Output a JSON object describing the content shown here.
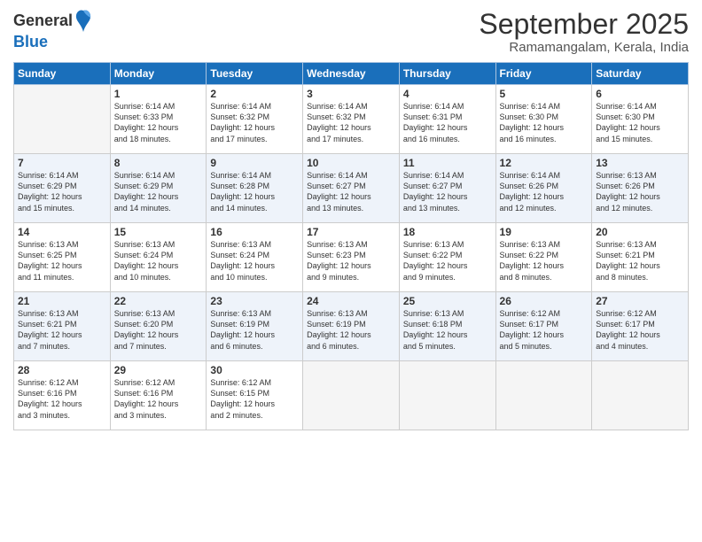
{
  "logo": {
    "general": "General",
    "blue": "Blue"
  },
  "title": "September 2025",
  "location": "Ramamangalam, Kerala, India",
  "days_of_week": [
    "Sunday",
    "Monday",
    "Tuesday",
    "Wednesday",
    "Thursday",
    "Friday",
    "Saturday"
  ],
  "weeks": [
    [
      {
        "day": "",
        "info": ""
      },
      {
        "day": "1",
        "info": "Sunrise: 6:14 AM\nSunset: 6:33 PM\nDaylight: 12 hours\nand 18 minutes."
      },
      {
        "day": "2",
        "info": "Sunrise: 6:14 AM\nSunset: 6:32 PM\nDaylight: 12 hours\nand 17 minutes."
      },
      {
        "day": "3",
        "info": "Sunrise: 6:14 AM\nSunset: 6:32 PM\nDaylight: 12 hours\nand 17 minutes."
      },
      {
        "day": "4",
        "info": "Sunrise: 6:14 AM\nSunset: 6:31 PM\nDaylight: 12 hours\nand 16 minutes."
      },
      {
        "day": "5",
        "info": "Sunrise: 6:14 AM\nSunset: 6:30 PM\nDaylight: 12 hours\nand 16 minutes."
      },
      {
        "day": "6",
        "info": "Sunrise: 6:14 AM\nSunset: 6:30 PM\nDaylight: 12 hours\nand 15 minutes."
      }
    ],
    [
      {
        "day": "7",
        "info": "Sunrise: 6:14 AM\nSunset: 6:29 PM\nDaylight: 12 hours\nand 15 minutes."
      },
      {
        "day": "8",
        "info": "Sunrise: 6:14 AM\nSunset: 6:29 PM\nDaylight: 12 hours\nand 14 minutes."
      },
      {
        "day": "9",
        "info": "Sunrise: 6:14 AM\nSunset: 6:28 PM\nDaylight: 12 hours\nand 14 minutes."
      },
      {
        "day": "10",
        "info": "Sunrise: 6:14 AM\nSunset: 6:27 PM\nDaylight: 12 hours\nand 13 minutes."
      },
      {
        "day": "11",
        "info": "Sunrise: 6:14 AM\nSunset: 6:27 PM\nDaylight: 12 hours\nand 13 minutes."
      },
      {
        "day": "12",
        "info": "Sunrise: 6:14 AM\nSunset: 6:26 PM\nDaylight: 12 hours\nand 12 minutes."
      },
      {
        "day": "13",
        "info": "Sunrise: 6:13 AM\nSunset: 6:26 PM\nDaylight: 12 hours\nand 12 minutes."
      }
    ],
    [
      {
        "day": "14",
        "info": "Sunrise: 6:13 AM\nSunset: 6:25 PM\nDaylight: 12 hours\nand 11 minutes."
      },
      {
        "day": "15",
        "info": "Sunrise: 6:13 AM\nSunset: 6:24 PM\nDaylight: 12 hours\nand 10 minutes."
      },
      {
        "day": "16",
        "info": "Sunrise: 6:13 AM\nSunset: 6:24 PM\nDaylight: 12 hours\nand 10 minutes."
      },
      {
        "day": "17",
        "info": "Sunrise: 6:13 AM\nSunset: 6:23 PM\nDaylight: 12 hours\nand 9 minutes."
      },
      {
        "day": "18",
        "info": "Sunrise: 6:13 AM\nSunset: 6:22 PM\nDaylight: 12 hours\nand 9 minutes."
      },
      {
        "day": "19",
        "info": "Sunrise: 6:13 AM\nSunset: 6:22 PM\nDaylight: 12 hours\nand 8 minutes."
      },
      {
        "day": "20",
        "info": "Sunrise: 6:13 AM\nSunset: 6:21 PM\nDaylight: 12 hours\nand 8 minutes."
      }
    ],
    [
      {
        "day": "21",
        "info": "Sunrise: 6:13 AM\nSunset: 6:21 PM\nDaylight: 12 hours\nand 7 minutes."
      },
      {
        "day": "22",
        "info": "Sunrise: 6:13 AM\nSunset: 6:20 PM\nDaylight: 12 hours\nand 7 minutes."
      },
      {
        "day": "23",
        "info": "Sunrise: 6:13 AM\nSunset: 6:19 PM\nDaylight: 12 hours\nand 6 minutes."
      },
      {
        "day": "24",
        "info": "Sunrise: 6:13 AM\nSunset: 6:19 PM\nDaylight: 12 hours\nand 6 minutes."
      },
      {
        "day": "25",
        "info": "Sunrise: 6:13 AM\nSunset: 6:18 PM\nDaylight: 12 hours\nand 5 minutes."
      },
      {
        "day": "26",
        "info": "Sunrise: 6:12 AM\nSunset: 6:17 PM\nDaylight: 12 hours\nand 5 minutes."
      },
      {
        "day": "27",
        "info": "Sunrise: 6:12 AM\nSunset: 6:17 PM\nDaylight: 12 hours\nand 4 minutes."
      }
    ],
    [
      {
        "day": "28",
        "info": "Sunrise: 6:12 AM\nSunset: 6:16 PM\nDaylight: 12 hours\nand 3 minutes."
      },
      {
        "day": "29",
        "info": "Sunrise: 6:12 AM\nSunset: 6:16 PM\nDaylight: 12 hours\nand 3 minutes."
      },
      {
        "day": "30",
        "info": "Sunrise: 6:12 AM\nSunset: 6:15 PM\nDaylight: 12 hours\nand 2 minutes."
      },
      {
        "day": "",
        "info": ""
      },
      {
        "day": "",
        "info": ""
      },
      {
        "day": "",
        "info": ""
      },
      {
        "day": "",
        "info": ""
      }
    ]
  ]
}
